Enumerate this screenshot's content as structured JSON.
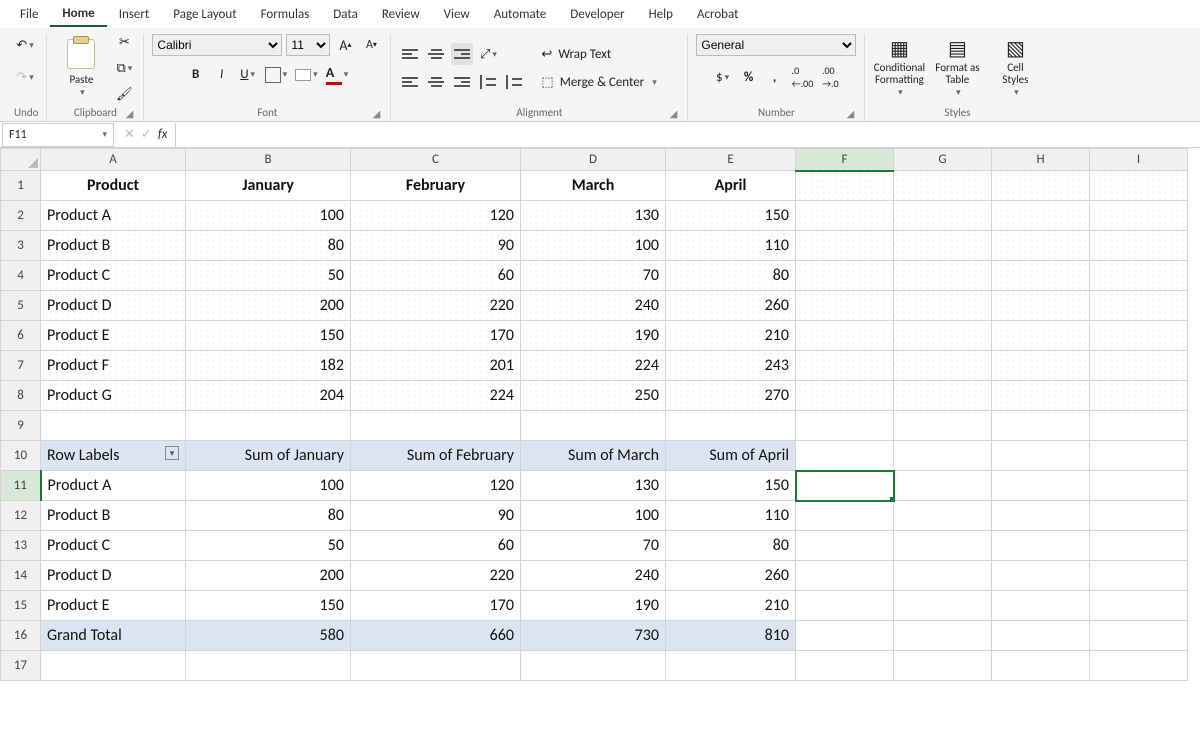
{
  "menu": {
    "items": [
      "File",
      "Home",
      "Insert",
      "Page Layout",
      "Formulas",
      "Data",
      "Review",
      "View",
      "Automate",
      "Developer",
      "Help",
      "Acrobat"
    ],
    "active": "Home"
  },
  "ribbon": {
    "groups": {
      "undo": "Undo",
      "clipboard": "Clipboard",
      "font": "Font",
      "alignment": "Alignment",
      "number": "Number",
      "styles": "Styles"
    },
    "pasteLabel": "Paste",
    "fontName": "Calibri",
    "fontSize": "11",
    "wrapText": "Wrap Text",
    "mergeCenter": "Merge & Center",
    "numberFormat": "General",
    "conditionalFormatting": "Conditional\nFormatting",
    "formatAsTable": "Format as\nTable",
    "cellStyles": "Cell\nStyles"
  },
  "nameBox": "F11",
  "formula": "",
  "columns": [
    "A",
    "B",
    "C",
    "D",
    "E",
    "F",
    "G",
    "H",
    "I"
  ],
  "rowCount": 17,
  "activeCell": {
    "row": 11,
    "col": "F"
  },
  "cells": {
    "table1": {
      "headers": [
        "Product",
        "January",
        "February",
        "March",
        "April"
      ],
      "rows": [
        [
          "Product A",
          "100",
          "120",
          "130",
          "150"
        ],
        [
          "Product B",
          "80",
          "90",
          "100",
          "110"
        ],
        [
          "Product C",
          "50",
          "60",
          "70",
          "80"
        ],
        [
          "Product D",
          "200",
          "220",
          "240",
          "260"
        ],
        [
          "Product E",
          "150",
          "170",
          "190",
          "210"
        ],
        [
          "Product F",
          "182",
          "201",
          "224",
          "243"
        ],
        [
          "Product G",
          "204",
          "224",
          "250",
          "270"
        ]
      ]
    },
    "pivot": {
      "headers": [
        "Row Labels",
        "Sum of January",
        "Sum of February",
        "Sum of March",
        "Sum of April"
      ],
      "rows": [
        [
          "Product A",
          "100",
          "120",
          "130",
          "150"
        ],
        [
          "Product B",
          "80",
          "90",
          "100",
          "110"
        ],
        [
          "Product C",
          "50",
          "60",
          "70",
          "80"
        ],
        [
          "Product D",
          "200",
          "220",
          "240",
          "260"
        ],
        [
          "Product E",
          "150",
          "170",
          "190",
          "210"
        ]
      ],
      "totalLabel": "Grand Total",
      "totals": [
        "580",
        "660",
        "730",
        "810"
      ]
    }
  }
}
